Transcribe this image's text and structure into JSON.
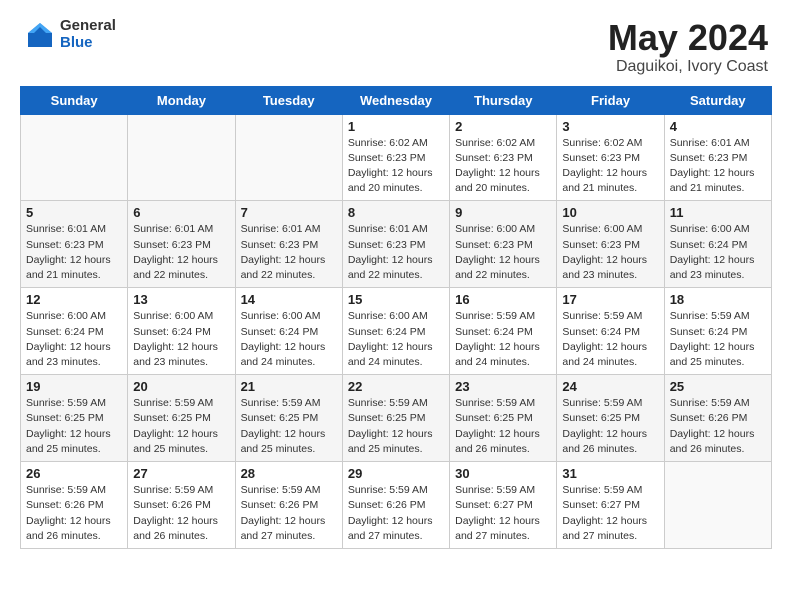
{
  "header": {
    "logo_general": "General",
    "logo_blue": "Blue",
    "month_year": "May 2024",
    "location": "Daguikoi, Ivory Coast"
  },
  "weekdays": [
    "Sunday",
    "Monday",
    "Tuesday",
    "Wednesday",
    "Thursday",
    "Friday",
    "Saturday"
  ],
  "weeks": [
    [
      {
        "day": "",
        "info": ""
      },
      {
        "day": "",
        "info": ""
      },
      {
        "day": "",
        "info": ""
      },
      {
        "day": "1",
        "info": "Sunrise: 6:02 AM\nSunset: 6:23 PM\nDaylight: 12 hours\nand 20 minutes."
      },
      {
        "day": "2",
        "info": "Sunrise: 6:02 AM\nSunset: 6:23 PM\nDaylight: 12 hours\nand 20 minutes."
      },
      {
        "day": "3",
        "info": "Sunrise: 6:02 AM\nSunset: 6:23 PM\nDaylight: 12 hours\nand 21 minutes."
      },
      {
        "day": "4",
        "info": "Sunrise: 6:01 AM\nSunset: 6:23 PM\nDaylight: 12 hours\nand 21 minutes."
      }
    ],
    [
      {
        "day": "5",
        "info": "Sunrise: 6:01 AM\nSunset: 6:23 PM\nDaylight: 12 hours\nand 21 minutes."
      },
      {
        "day": "6",
        "info": "Sunrise: 6:01 AM\nSunset: 6:23 PM\nDaylight: 12 hours\nand 22 minutes."
      },
      {
        "day": "7",
        "info": "Sunrise: 6:01 AM\nSunset: 6:23 PM\nDaylight: 12 hours\nand 22 minutes."
      },
      {
        "day": "8",
        "info": "Sunrise: 6:01 AM\nSunset: 6:23 PM\nDaylight: 12 hours\nand 22 minutes."
      },
      {
        "day": "9",
        "info": "Sunrise: 6:00 AM\nSunset: 6:23 PM\nDaylight: 12 hours\nand 22 minutes."
      },
      {
        "day": "10",
        "info": "Sunrise: 6:00 AM\nSunset: 6:23 PM\nDaylight: 12 hours\nand 23 minutes."
      },
      {
        "day": "11",
        "info": "Sunrise: 6:00 AM\nSunset: 6:24 PM\nDaylight: 12 hours\nand 23 minutes."
      }
    ],
    [
      {
        "day": "12",
        "info": "Sunrise: 6:00 AM\nSunset: 6:24 PM\nDaylight: 12 hours\nand 23 minutes."
      },
      {
        "day": "13",
        "info": "Sunrise: 6:00 AM\nSunset: 6:24 PM\nDaylight: 12 hours\nand 23 minutes."
      },
      {
        "day": "14",
        "info": "Sunrise: 6:00 AM\nSunset: 6:24 PM\nDaylight: 12 hours\nand 24 minutes."
      },
      {
        "day": "15",
        "info": "Sunrise: 6:00 AM\nSunset: 6:24 PM\nDaylight: 12 hours\nand 24 minutes."
      },
      {
        "day": "16",
        "info": "Sunrise: 5:59 AM\nSunset: 6:24 PM\nDaylight: 12 hours\nand 24 minutes."
      },
      {
        "day": "17",
        "info": "Sunrise: 5:59 AM\nSunset: 6:24 PM\nDaylight: 12 hours\nand 24 minutes."
      },
      {
        "day": "18",
        "info": "Sunrise: 5:59 AM\nSunset: 6:24 PM\nDaylight: 12 hours\nand 25 minutes."
      }
    ],
    [
      {
        "day": "19",
        "info": "Sunrise: 5:59 AM\nSunset: 6:25 PM\nDaylight: 12 hours\nand 25 minutes."
      },
      {
        "day": "20",
        "info": "Sunrise: 5:59 AM\nSunset: 6:25 PM\nDaylight: 12 hours\nand 25 minutes."
      },
      {
        "day": "21",
        "info": "Sunrise: 5:59 AM\nSunset: 6:25 PM\nDaylight: 12 hours\nand 25 minutes."
      },
      {
        "day": "22",
        "info": "Sunrise: 5:59 AM\nSunset: 6:25 PM\nDaylight: 12 hours\nand 25 minutes."
      },
      {
        "day": "23",
        "info": "Sunrise: 5:59 AM\nSunset: 6:25 PM\nDaylight: 12 hours\nand 26 minutes."
      },
      {
        "day": "24",
        "info": "Sunrise: 5:59 AM\nSunset: 6:25 PM\nDaylight: 12 hours\nand 26 minutes."
      },
      {
        "day": "25",
        "info": "Sunrise: 5:59 AM\nSunset: 6:26 PM\nDaylight: 12 hours\nand 26 minutes."
      }
    ],
    [
      {
        "day": "26",
        "info": "Sunrise: 5:59 AM\nSunset: 6:26 PM\nDaylight: 12 hours\nand 26 minutes."
      },
      {
        "day": "27",
        "info": "Sunrise: 5:59 AM\nSunset: 6:26 PM\nDaylight: 12 hours\nand 26 minutes."
      },
      {
        "day": "28",
        "info": "Sunrise: 5:59 AM\nSunset: 6:26 PM\nDaylight: 12 hours\nand 27 minutes."
      },
      {
        "day": "29",
        "info": "Sunrise: 5:59 AM\nSunset: 6:26 PM\nDaylight: 12 hours\nand 27 minutes."
      },
      {
        "day": "30",
        "info": "Sunrise: 5:59 AM\nSunset: 6:27 PM\nDaylight: 12 hours\nand 27 minutes."
      },
      {
        "day": "31",
        "info": "Sunrise: 5:59 AM\nSunset: 6:27 PM\nDaylight: 12 hours\nand 27 minutes."
      },
      {
        "day": "",
        "info": ""
      }
    ]
  ]
}
